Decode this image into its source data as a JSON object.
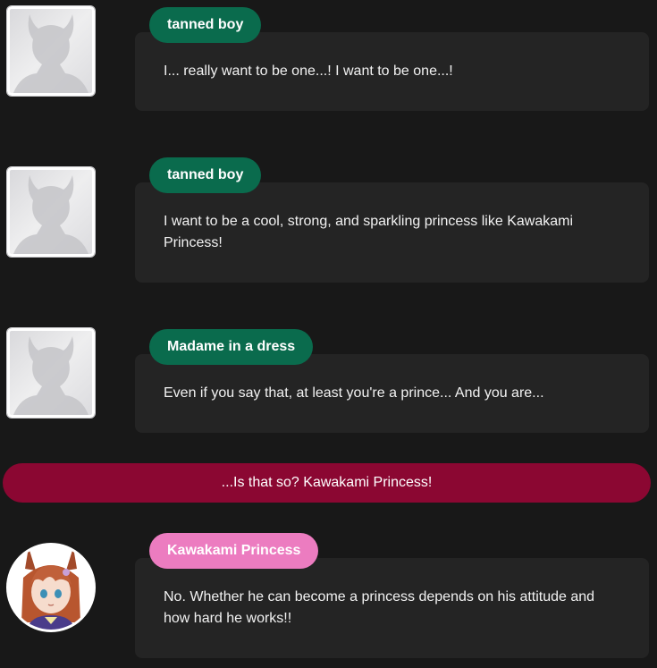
{
  "messages": [
    {
      "speaker": "tanned boy",
      "text": "I... really want to be one...! I want to be one...!",
      "avatar_icon": "silhouette-placeholder-icon",
      "tag_color": "#0a6b4d"
    },
    {
      "speaker": "tanned boy",
      "text": "I want to be a cool, strong, and sparkling princess like Kawakami Princess!",
      "avatar_icon": "silhouette-placeholder-icon",
      "tag_color": "#0a6b4d"
    },
    {
      "speaker": "Madame in a dress",
      "text": "Even if you say that, at least you're a prince... And you are...",
      "avatar_icon": "silhouette-placeholder-icon",
      "tag_color": "#0a6b4d"
    },
    {
      "speaker": "Kawakami Princess",
      "text": "No. Whether he can become a princess depends on his attitude and how hard he works!!",
      "avatar_icon": "character-portrait",
      "tag_color": "#ec7cc0"
    }
  ],
  "choice": {
    "label": "...Is that so? Kawakami Princess!",
    "color": "#8b0732"
  },
  "colors": {
    "background": "#181818",
    "bubble": "#242424"
  }
}
